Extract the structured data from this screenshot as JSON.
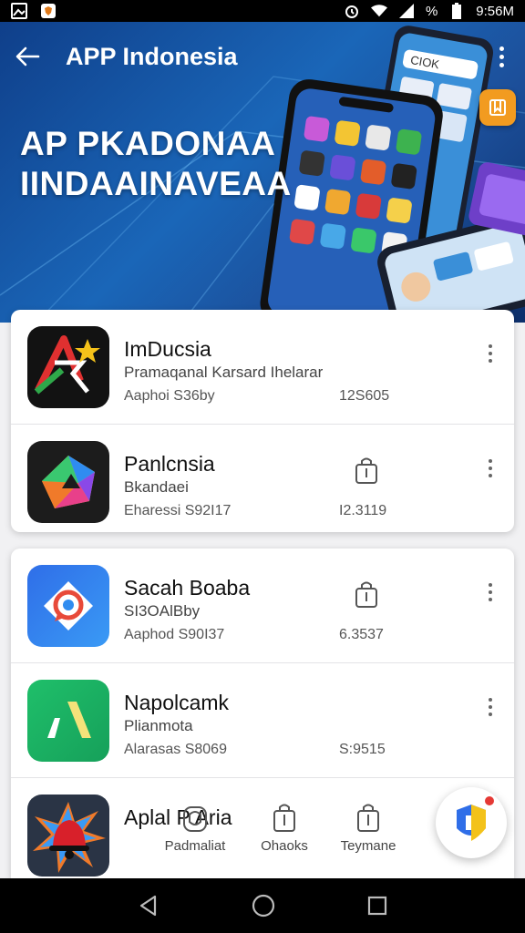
{
  "status_bar": {
    "time": "9:56M",
    "percent": "%",
    "icons": [
      "gallery-icon",
      "shield-app-icon",
      "alarm-icon",
      "wifi-icon",
      "signal-icon",
      "battery-icon"
    ]
  },
  "header": {
    "title": "APP Indonesia",
    "back_icon": "arrow-left-icon",
    "menu_icon": "more-vert-icon"
  },
  "hero": {
    "headline_line1": "AP PKADONAA",
    "headline_line2": "IINDAAINAVEAA",
    "phone_search_text": "CIOK"
  },
  "apps": [
    {
      "name": "ImDucsia",
      "subtitle": "Pramaqanal Karsard Ihelarar",
      "meta": "Aaphoi S36by",
      "count": "12S605",
      "icon": "star-a-logo-icon",
      "has_bag": false
    },
    {
      "name": "Panlcnsia",
      "subtitle": "Bkandaei",
      "meta": "Eharessi S92I17",
      "count": "I2.3119",
      "icon": "prism-logo-icon",
      "has_bag": true
    },
    {
      "name": "Sacah Boaba",
      "subtitle": "SI3OAlBby",
      "meta": "Aaphod S90I37",
      "count": "6.3537",
      "icon": "chat-bubble-logo-icon",
      "has_bag": true
    },
    {
      "name": "Napolcamk",
      "subtitle": "Plianmota",
      "meta": "Alarasas S8069",
      "count": "S:9515",
      "icon": "green-slash-logo-icon",
      "has_bag": false
    },
    {
      "name": "Aplal P Aria",
      "subtitle": "",
      "meta": "",
      "count": "",
      "icon": "bell-burst-logo-icon",
      "has_bag": false
    }
  ],
  "bottom_tabs": [
    {
      "label": "Padmaliat",
      "icon": "home-tab-icon"
    },
    {
      "label": "Ohaoks",
      "icon": "bag-tab-icon"
    },
    {
      "label": "Teymane",
      "icon": "bag-tab-icon"
    }
  ],
  "colors": {
    "hero_blue": "#1a66b8",
    "accent_orange": "#f29b20",
    "badge_red": "#e53935"
  }
}
